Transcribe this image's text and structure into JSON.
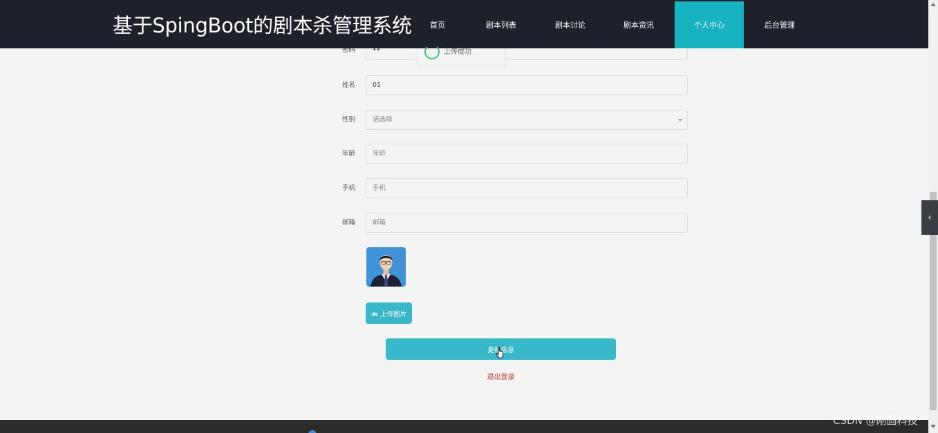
{
  "header": {
    "title": "基于SpingBoot的剧本杀管理系统",
    "nav": [
      {
        "label": "首页"
      },
      {
        "label": "剧本列表"
      },
      {
        "label": "剧本讨论"
      },
      {
        "label": "剧本资讯"
      },
      {
        "label": "个人中心",
        "active": true
      },
      {
        "label": "后台管理"
      }
    ]
  },
  "toast": {
    "text": "上传成功"
  },
  "form": {
    "password": {
      "label": "密码",
      "value": "••"
    },
    "name": {
      "label": "姓名",
      "value": "01"
    },
    "gender": {
      "label": "性别",
      "placeholder": "请选择"
    },
    "age": {
      "label": "年龄",
      "placeholder": "年龄"
    },
    "phone": {
      "label": "手机",
      "placeholder": "手机"
    },
    "email": {
      "label": "邮箱",
      "placeholder": "邮箱"
    }
  },
  "upload_label": "上传图片",
  "update_label": "更新信息",
  "logout_label": "退出登录",
  "side_tab_icon": "‹",
  "watermark": "CSDN @刚圆科技",
  "colors": {
    "accent": "#38b8c8",
    "nav_bg": "#1e2129",
    "nav_active": "#17b3c1",
    "logout": "#c0392b"
  }
}
